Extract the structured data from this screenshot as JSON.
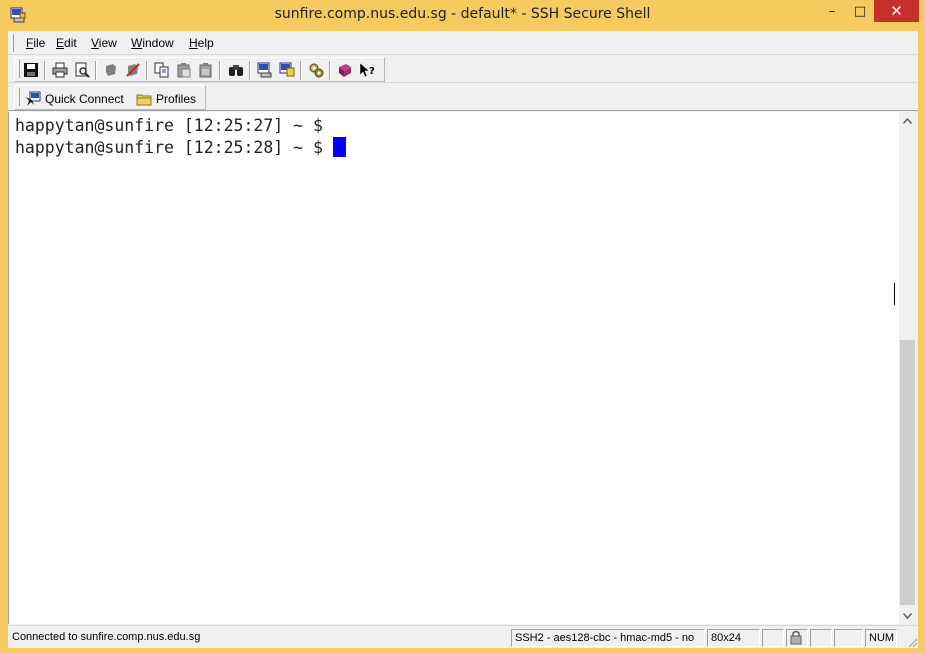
{
  "window": {
    "title": "sunfire.comp.nus.edu.sg - default* - SSH Secure Shell",
    "minimize": "–",
    "maximize": "□",
    "close": "✕"
  },
  "menu": [
    {
      "label": "File",
      "accel": "F",
      "rest": "ile"
    },
    {
      "label": "Edit",
      "accel": "E",
      "rest": "dit"
    },
    {
      "label": "View",
      "accel": "V",
      "rest": "iew"
    },
    {
      "label": "Window",
      "accel": "W",
      "rest": "indow"
    },
    {
      "label": "Help",
      "accel": "H",
      "rest": "elp"
    }
  ],
  "toolbar": {
    "icons": [
      "save-icon",
      "print-icon",
      "print-preview-icon",
      "disconnect-icon",
      "remove-icon",
      "copy-icon",
      "paste-icon",
      "paste-special-icon",
      "find-icon",
      "new-terminal-icon",
      "new-file-transfer-icon",
      "settings-icon",
      "help-topics-icon",
      "context-help-icon"
    ]
  },
  "linkbar": {
    "quick_connect": "Quick Connect",
    "profiles": "Profiles"
  },
  "terminal": {
    "lines": [
      "happytan@sunfire [12:25:27] ~ $",
      "happytan@sunfire [12:25:28] ~ $ "
    ],
    "cursor_color": "#0000ff"
  },
  "statusbar": {
    "connection": "Connected to sunfire.comp.nus.edu.sg",
    "cipher": "SSH2 - aes128-cbc - hmac-md5 - no",
    "size": "80x24",
    "num": "NUM"
  },
  "colors": {
    "frame": "#f5ca5e",
    "close_button": "#c7302b",
    "terminal_bg": "#ffffff"
  }
}
